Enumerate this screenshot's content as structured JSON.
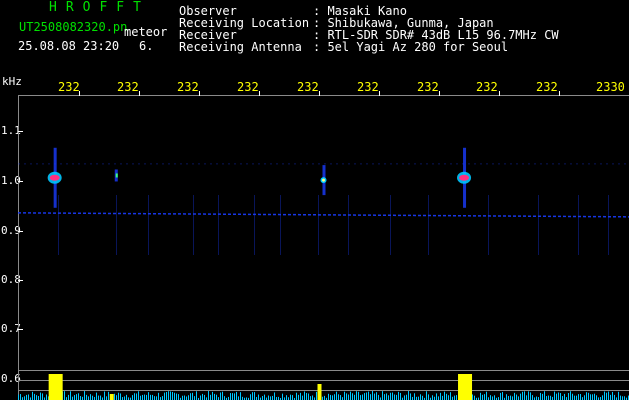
{
  "header": {
    "brand": "HROFFT",
    "filename": "UT2508082320.pn",
    "meteor_label": "meteor",
    "datetime": "25.08.08 23:20",
    "meteor_count": "6."
  },
  "info": {
    "rows": [
      {
        "label": "Observer",
        "value": ": Masaki Kano"
      },
      {
        "label": "Receiving Location",
        "value": ": Shibukawa, Gunma, Japan"
      },
      {
        "label": "Receiver",
        "value": ": RTL-SDR SDR# 43dB L15 96.7MHz CW"
      },
      {
        "label": "Receiving Antenna",
        "value": ": 5el Yagi Az 280 for Seoul"
      }
    ]
  },
  "axis": {
    "unit": "kHz",
    "x_ticks": [
      "232",
      "232",
      "232",
      "232",
      "232",
      "232",
      "232",
      "232",
      "232",
      "2330"
    ],
    "y_ticks": [
      "1.1",
      "1.0",
      "0.9",
      "0.8",
      "0.7",
      "0.6"
    ]
  },
  "colors": {
    "background": "#000000",
    "header_text": "#ffffff",
    "brand": "#00e000",
    "axis_labels": "#ffff00",
    "grid": "#8a8a8a",
    "carrier": "#1a3cff",
    "echo_hot": "#ff3080",
    "histogram_noise": "#00c8ff",
    "histogram_peak": "#ffff00"
  },
  "spectrogram": {
    "carrier_freq_khz": 0.855,
    "echoes": [
      {
        "time_min": 0.6,
        "freq_khz": 0.935,
        "strength": "strong"
      },
      {
        "time_min": 1.6,
        "freq_khz": 0.94,
        "strength": "weak"
      },
      {
        "time_min": 5.0,
        "freq_khz": 0.93,
        "strength": "medium"
      },
      {
        "time_min": 7.3,
        "freq_khz": 0.935,
        "strength": "strong"
      }
    ]
  }
}
